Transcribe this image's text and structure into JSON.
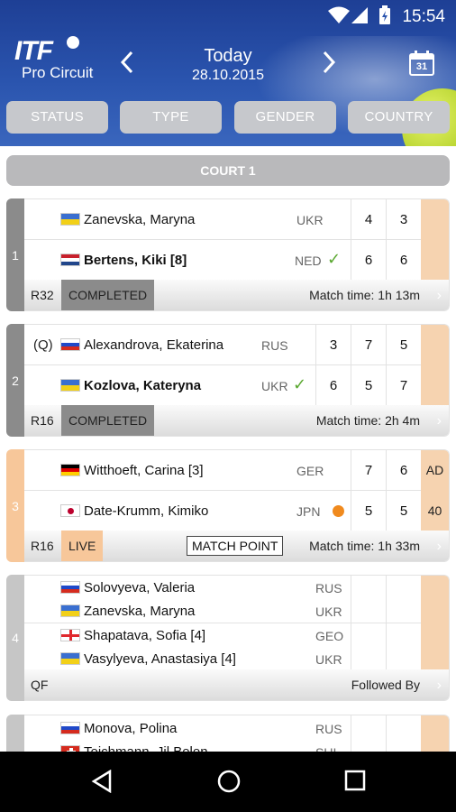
{
  "status_bar": {
    "time": "15:54"
  },
  "header": {
    "logo_top": "ITF",
    "logo_bottom": "Pro Circuit",
    "date_label": "Today",
    "date": "28.10.2015",
    "calendar_day": "31",
    "filters": [
      "STATUS",
      "TYPE",
      "GENDER",
      "COUNTRY"
    ]
  },
  "court_title": "COURT 1",
  "colors": {
    "completed": "#8b8b8b",
    "live": "#f7c79a",
    "scheduled": "#c6c6c6",
    "point_cell": "#f6d3b0"
  },
  "matches": [
    {
      "number": "1",
      "players": [
        {
          "seed": "",
          "flag": "ukr",
          "name": "Zanevska, Maryna",
          "country": "UKR",
          "winner": false,
          "scores": [
            "4",
            "3"
          ],
          "point": ""
        },
        {
          "seed": "",
          "flag": "ned",
          "name": "Bertens, Kiki [8]",
          "country": "NED",
          "winner": true,
          "scores": [
            "6",
            "6"
          ],
          "point": ""
        }
      ],
      "round": "R32",
      "status": "COMPLETED",
      "match_time": "Match time: 1h 13m"
    },
    {
      "number": "2",
      "players": [
        {
          "seed": "(Q)",
          "flag": "rus",
          "name": "Alexandrova, Ekaterina",
          "country": "RUS",
          "winner": false,
          "scores": [
            "3",
            "7",
            "5"
          ],
          "point": ""
        },
        {
          "seed": "",
          "flag": "ukr",
          "name": "Kozlova, Kateryna",
          "country": "UKR",
          "winner": true,
          "scores": [
            "6",
            "5",
            "7"
          ],
          "point": ""
        }
      ],
      "round": "R16",
      "status": "COMPLETED",
      "match_time": "Match time: 2h 4m"
    },
    {
      "number": "3",
      "players": [
        {
          "seed": "",
          "flag": "ger",
          "name": "Witthoeft, Carina [3]",
          "country": "GER",
          "winner": false,
          "scores": [
            "7",
            "6"
          ],
          "point": "AD"
        },
        {
          "seed": "",
          "flag": "jpn",
          "name": "Date-Krumm, Kimiko",
          "country": "JPN",
          "serving": true,
          "scores": [
            "5",
            "5"
          ],
          "point": "40"
        }
      ],
      "round": "R16",
      "status": "LIVE",
      "badge": "MATCH POINT",
      "match_time": "Match time: 1h 33m"
    },
    {
      "number": "4",
      "players": [
        {
          "flag": "rus",
          "name": "Solovyeva, Valeria",
          "country": "RUS"
        },
        {
          "flag": "ukr",
          "name": "Zanevska, Maryna",
          "country": "UKR"
        },
        {
          "flag": "geo",
          "name": "Shapatava, Sofia [4]",
          "country": "GEO"
        },
        {
          "flag": "ukr",
          "name": "Vasylyeva, Anastasiya [4]",
          "country": "UKR"
        }
      ],
      "round": "QF",
      "status": "Followed By"
    },
    {
      "number": "",
      "players": [
        {
          "flag": "rus",
          "name": "Monova, Polina",
          "country": "RUS"
        },
        {
          "flag": "sui",
          "name": "Teichmann, Jil Belen",
          "country": "SUI"
        }
      ]
    }
  ]
}
